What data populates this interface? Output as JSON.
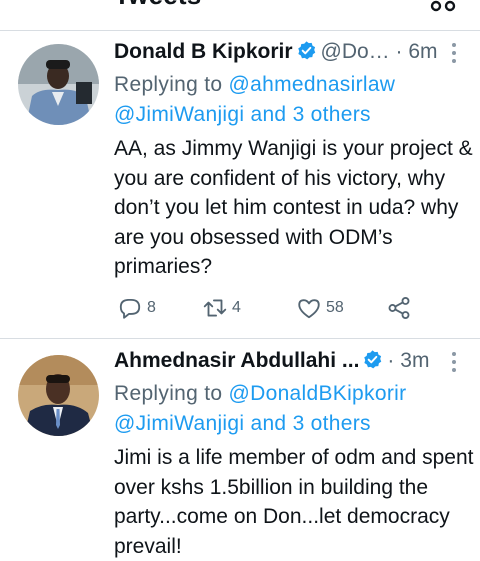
{
  "header": {
    "title": "Tweets"
  },
  "tweets": [
    {
      "name": "Donald B Kipkorir",
      "handle": "@Do…",
      "dot": "·",
      "time": "6m",
      "reply_prefix": "Replying to",
      "reply_user1": "@ahmednasirlaw",
      "reply_user2": "@JimiWanjigi",
      "reply_and": "and",
      "reply_others": "3 others",
      "body": "AA, as Jimmy Wanjigi is your project & you are confident of his victory, why don’t you let him contest in uda? why are you obsessed with ODM’s primaries?",
      "replies": "8",
      "retweets": "4",
      "likes": "58"
    },
    {
      "name": "Ahmednasir Abdullahi ...",
      "time": "3m",
      "reply_prefix": "Replying to",
      "reply_user1": "@DonaldBKipkorir",
      "reply_user2": "@JimiWanjigi",
      "reply_and": "and",
      "reply_others": "3 others",
      "body": "Jimi is a life member of odm and spent over kshs 1.5billion in building the party...come on Don...let democracy prevail!"
    }
  ],
  "colors": {
    "accent": "#1d9bf0",
    "secondary_text": "#536471",
    "divider": "#d8dde2"
  }
}
